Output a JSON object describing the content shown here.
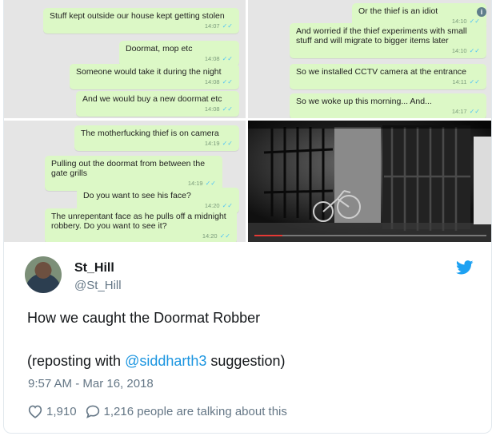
{
  "chat_top_left": [
    {
      "text": "Stuff kept outside our house kept getting stolen",
      "time": "14:07"
    },
    {
      "text": "Doormat, mop etc",
      "time": "14:08"
    },
    {
      "text": "Someone would take it during the night",
      "time": "14:08"
    },
    {
      "text": "And we would buy a new doormat etc",
      "time": "14:08"
    }
  ],
  "chat_top_right": [
    {
      "text": "Or the thief is an idiot",
      "time": "14:10"
    },
    {
      "text": "And worried if the thief experiments with small stuff and will migrate to bigger items later",
      "time": "14:10"
    },
    {
      "text": "So we installed CCTV camera at the entrance",
      "time": "14:11"
    },
    {
      "text": "So we woke up this morning... And...",
      "time": "14:17"
    }
  ],
  "chat_bottom_left": [
    {
      "text": "The motherfucking thief is on camera",
      "time": "14:19"
    },
    {
      "text": "Pulling out the doormat from between the gate grills",
      "time": "14:19"
    },
    {
      "text": "Do you want to see his face?",
      "time": "14:20"
    },
    {
      "text": "The unrepentant face as he pulls off a midnight robbery. Do you want to see it?",
      "time": "14:20"
    }
  ],
  "cctv": {
    "progress": 0.12
  },
  "tweet": {
    "name": "St_Hill",
    "handle": "@St_Hill",
    "text": "How we caught the Doormat Robber",
    "text2_prefix": "(reposting with ",
    "mention": "@siddharth3",
    "text2_suffix": " suggestion)",
    "timestamp": "9:57 AM - Mar 16, 2018",
    "likes": "1,910",
    "talking": "1,216 people are talking about this"
  },
  "colors": {
    "bubble": "#dcf8c6",
    "link": "#1b95e0",
    "twitter_blue": "#1da1f2"
  },
  "icons": [
    "twitter-bird-icon",
    "heart-icon",
    "reply-bubble-icon",
    "double-check-icon",
    "info-icon"
  ]
}
